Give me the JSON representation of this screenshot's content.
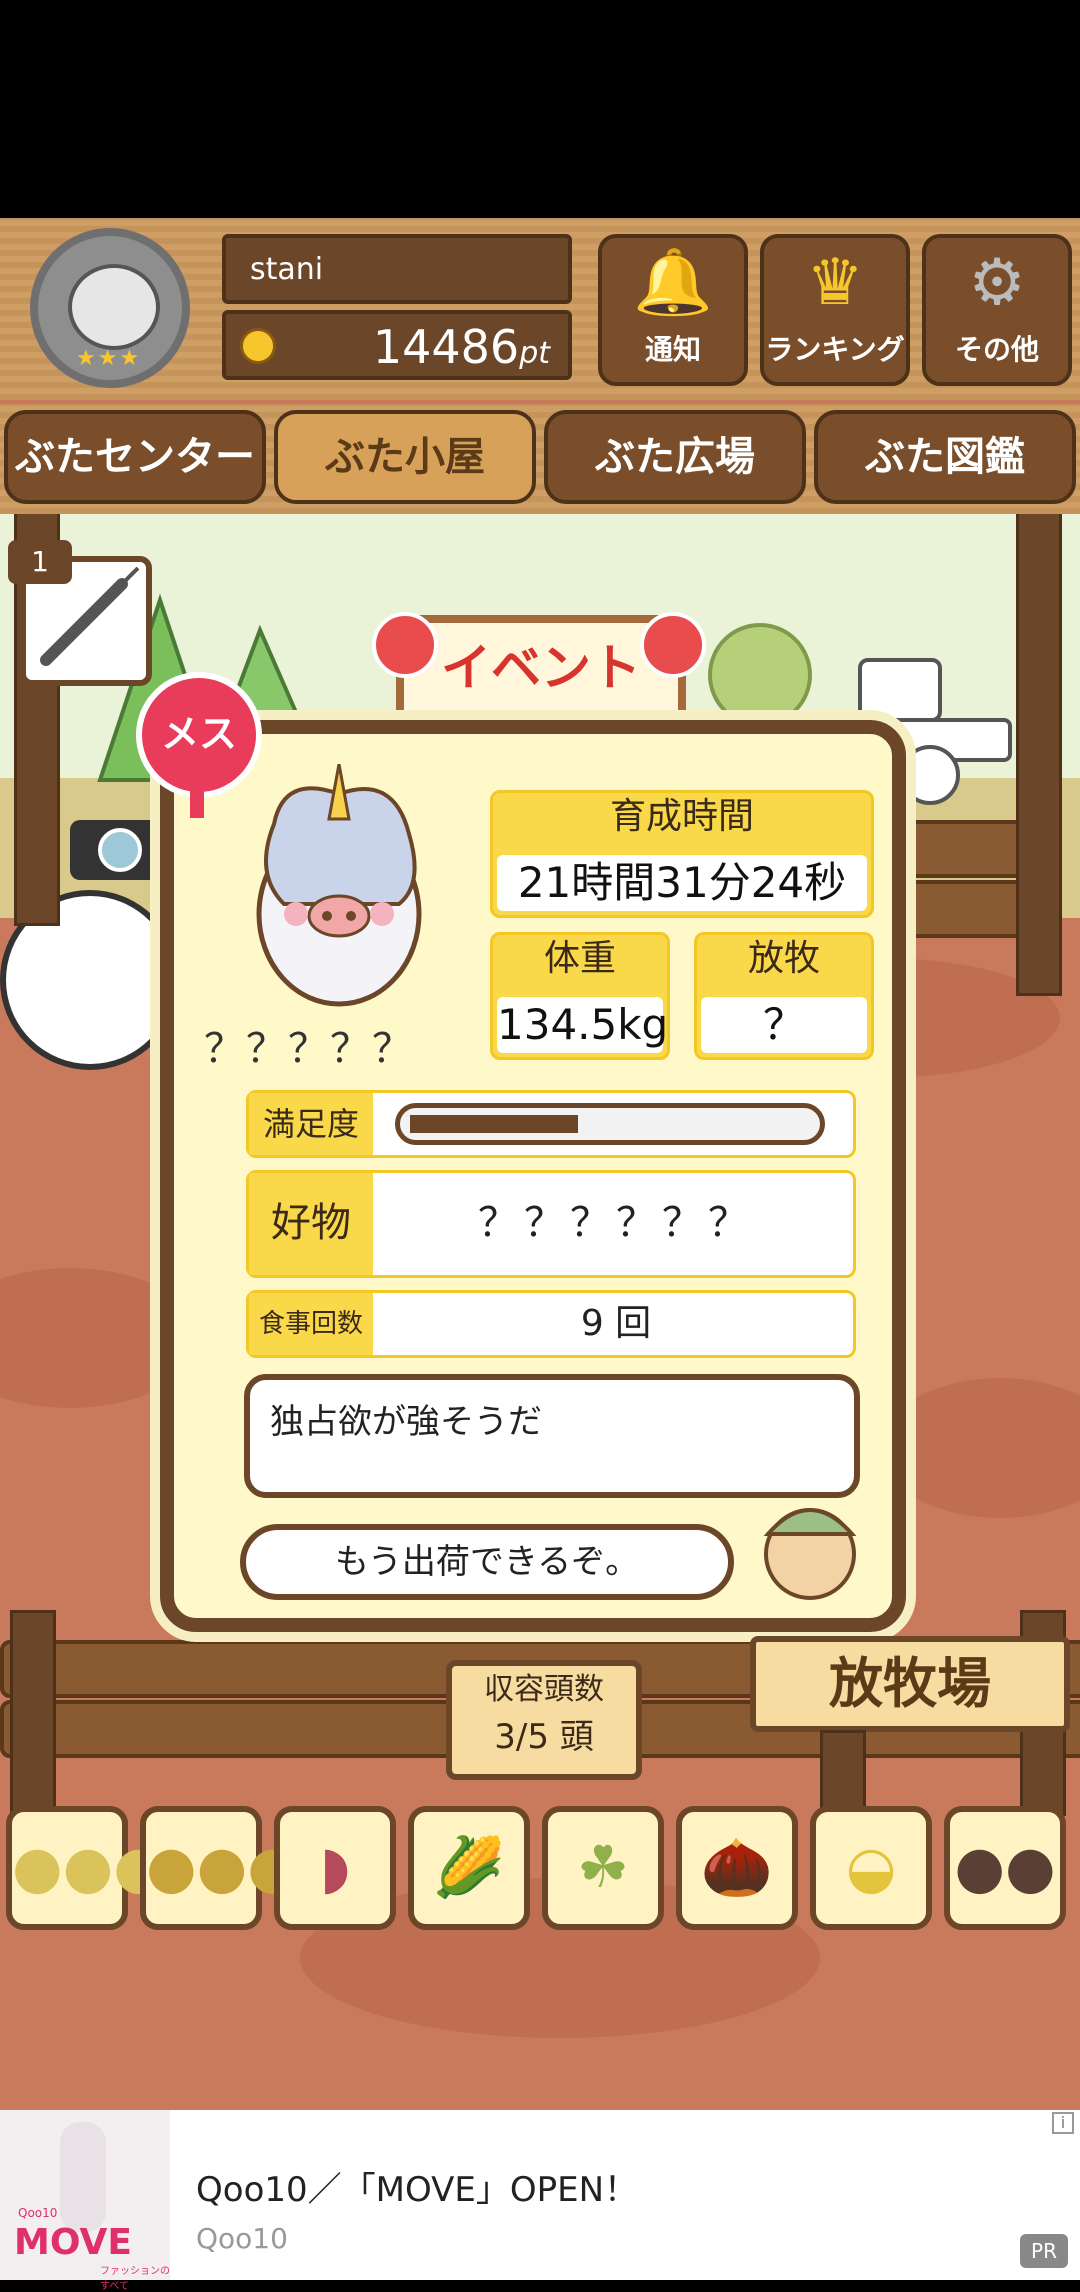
{
  "header": {
    "username": "stani",
    "points": "14486",
    "points_unit": "pt",
    "buttons": [
      {
        "label": "通知",
        "icon": "bell-icon"
      },
      {
        "label": "ランキング",
        "icon": "crown-icon"
      },
      {
        "label": "その他",
        "icon": "gear-icon"
      }
    ]
  },
  "tabs": [
    "ぶたセンター",
    "ぶた小屋",
    "ぶた広場",
    "ぶた図鑑"
  ],
  "active_tab": "ぶた小屋",
  "syringe_count": "1",
  "event_sign": "イベント",
  "pig": {
    "gender_label": "メス",
    "name": "？？？？？",
    "growth_time_label": "育成時間",
    "growth_time": "21時間31分24秒",
    "weight_label": "体重",
    "weight": "134.5kg",
    "grazing_label": "放牧",
    "grazing": "？",
    "satisfaction_label": "満足度",
    "satisfaction": 0.42,
    "favorite_label": "好物",
    "favorite": "？？？？？？",
    "meals_label": "食事回数",
    "meals": "9 回",
    "comment": "独占欲が強そうだ",
    "farmer_says": "もう出荷できるぞ。"
  },
  "capacity": {
    "label": "収容頭数",
    "value": "3/5 頭"
  },
  "pasture_sign": "放牧場",
  "foods": [
    "grain-pile-icon",
    "grain-pile-icon",
    "sweet-potato-icon",
    "corn-icon",
    "soybean-icon",
    "acorn-icon",
    "plate-grain-icon",
    "plate-meatball-icon"
  ],
  "ad": {
    "title": "Qoo10／「MOVE」OPEN！",
    "source": "Qoo10",
    "badge": "PR",
    "info": "i",
    "image_text": "MOVE",
    "image_logo": "Qoo10",
    "image_caption": "ファッションのすべて"
  },
  "colors": {
    "wood": "#7a4e2a",
    "yellow": "#f9d949",
    "panel": "#fff9c9"
  }
}
